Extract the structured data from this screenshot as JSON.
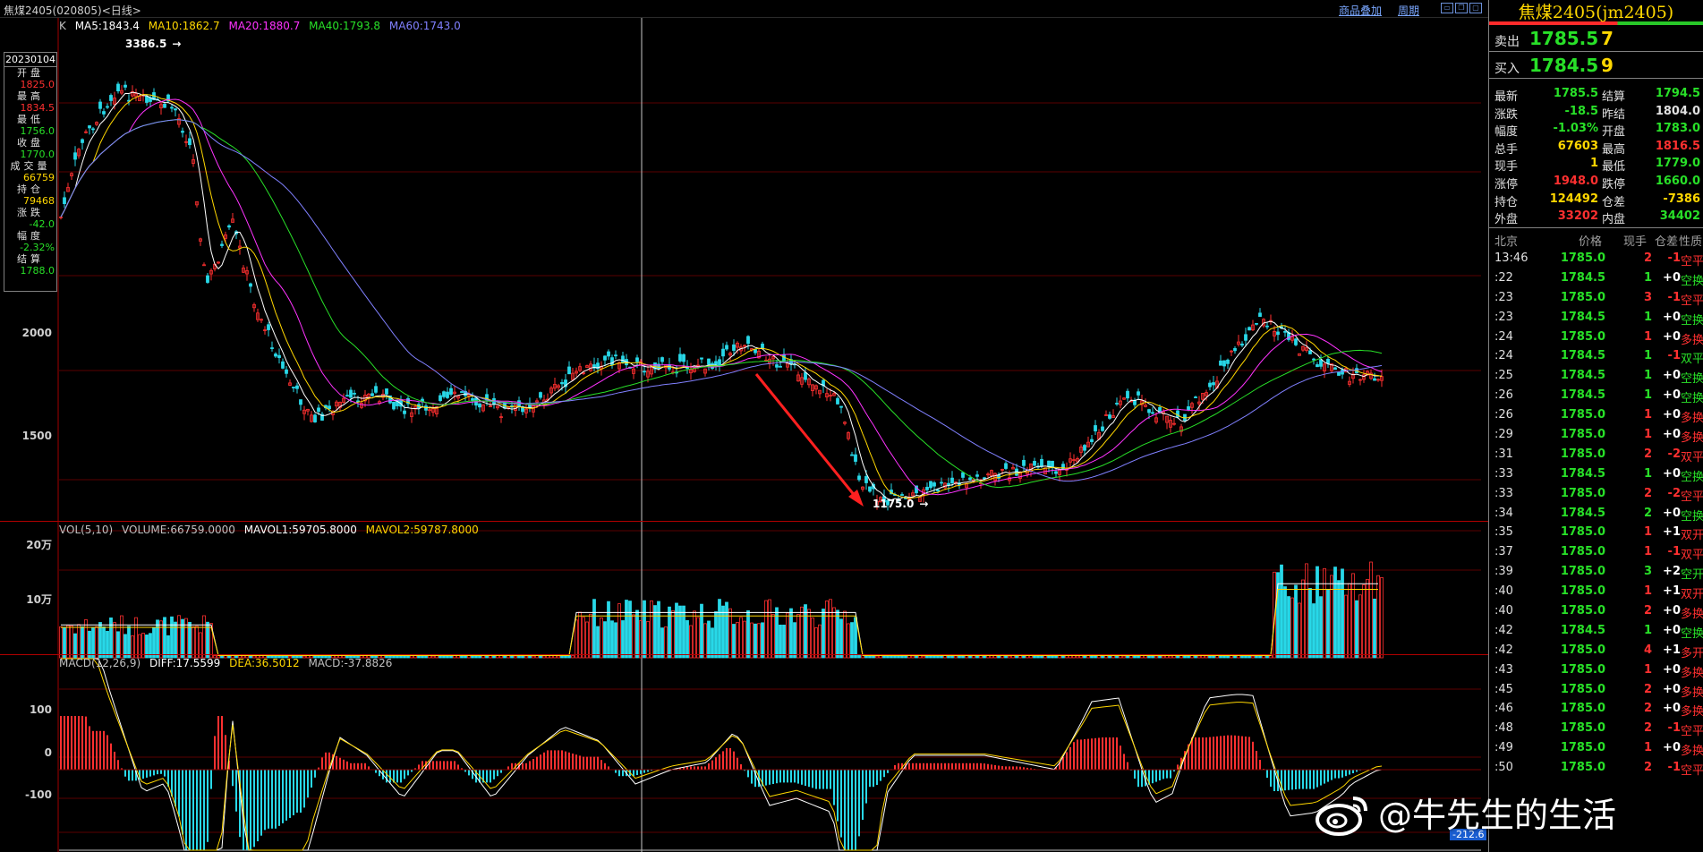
{
  "window": {
    "title": "焦煤2405(020805)<日线>",
    "links": [
      "商品叠加",
      "周期"
    ]
  },
  "kline": {
    "label": "K",
    "ma": [
      {
        "text": "MA5:1843.4",
        "color": "#ffffff"
      },
      {
        "text": "MA10:1862.7",
        "color": "#ffd700"
      },
      {
        "text": "MA20:1880.7",
        "color": "#ff33ff"
      },
      {
        "text": "MA40:1793.8",
        "color": "#28e028"
      },
      {
        "text": "MA60:1743.0",
        "color": "#8080ff"
      }
    ],
    "y_ticks": [
      "2000",
      "1500"
    ],
    "high_label": "3386.5",
    "low_label": "1175.0"
  },
  "info_box": {
    "date": "20230104",
    "items": [
      {
        "label": "开盘",
        "value": "1825.0",
        "color": "#ff3030"
      },
      {
        "label": "最高",
        "value": "1834.5",
        "color": "#ff3030"
      },
      {
        "label": "最低",
        "value": "1756.0",
        "color": "#28e028"
      },
      {
        "label": "收盘",
        "value": "1770.0",
        "color": "#28e028"
      },
      {
        "label": "成交量",
        "value": "66759",
        "color": "#ffd700"
      },
      {
        "label": "持仓",
        "value": "79468",
        "color": "#ffd700"
      },
      {
        "label": "涨跌",
        "value": "-42.0",
        "color": "#28e028"
      },
      {
        "label": "幅度",
        "value": "-2.32%",
        "color": "#28e028"
      },
      {
        "label": "结算",
        "value": "1788.0",
        "color": "#28e028"
      }
    ]
  },
  "volume": {
    "legend": [
      {
        "text": "VOL(5,10)",
        "color": "#c0c0c0"
      },
      {
        "text": "VOLUME:66759.0000",
        "color": "#c0c0c0"
      },
      {
        "text": "MAVOL1:59705.8000",
        "color": "#ffffff"
      },
      {
        "text": "MAVOL2:59787.8000",
        "color": "#ffd700"
      }
    ],
    "y_ticks": [
      "20万",
      "10万"
    ]
  },
  "macd": {
    "legend": [
      {
        "text": "MACD(12,26,9)",
        "color": "#c0c0c0"
      },
      {
        "text": "DIFF:17.5599",
        "color": "#ffffff"
      },
      {
        "text": "DEA:36.5012",
        "color": "#ffd700"
      },
      {
        "text": "MACD:-37.8826",
        "color": "#c0c0c0"
      }
    ],
    "y_ticks": [
      "100",
      "0",
      "-100"
    ],
    "low_label": "-212.6"
  },
  "panel": {
    "title": "焦煤2405(jm2405)",
    "sell": {
      "label": "卖出",
      "price": "1785.5",
      "volume": "7"
    },
    "buy": {
      "label": "买入",
      "price": "1784.5",
      "volume": "9"
    },
    "stats": [
      {
        "k1": "最新",
        "v1": "1785.5",
        "c1": "#28e028",
        "k2": "结算",
        "v2": "1794.5",
        "c2": "#28e028"
      },
      {
        "k1": "涨跌",
        "v1": "-18.5",
        "c1": "#28e028",
        "k2": "昨结",
        "v2": "1804.0",
        "c2": "#e0e0e0"
      },
      {
        "k1": "幅度",
        "v1": "-1.03%",
        "c1": "#28e028",
        "k2": "开盘",
        "v2": "1783.0",
        "c2": "#28e028"
      },
      {
        "k1": "总手",
        "v1": "67603",
        "c1": "#ffd700",
        "k2": "最高",
        "v2": "1816.5",
        "c2": "#ff3030"
      },
      {
        "k1": "现手",
        "v1": "1",
        "c1": "#ffd700",
        "k2": "最低",
        "v2": "1779.0",
        "c2": "#28e028"
      },
      {
        "k1": "涨停",
        "v1": "1948.0",
        "c1": "#ff3030",
        "k2": "跌停",
        "v2": "1660.0",
        "c2": "#28e028"
      },
      {
        "k1": "持仓",
        "v1": "124492",
        "c1": "#ffd700",
        "k2": "仓差",
        "v2": "-7386",
        "c2": "#ffd700"
      },
      {
        "k1": "外盘",
        "v1": "33202",
        "c1": "#ff3030",
        "k2": "内盘",
        "v2": "34402",
        "c2": "#28e028"
      }
    ],
    "tick_headers": [
      "北京",
      "价格",
      "现手",
      "仓差",
      "性质"
    ],
    "ticks": [
      {
        "time": "13:46",
        "price": "1785.0",
        "pc": "#28e028",
        "vol": "2",
        "vc": "#ff3030",
        "oi": "-1",
        "nature": "空平",
        "nc": "#ff3030"
      },
      {
        "time": ":22",
        "price": "1784.5",
        "pc": "#28e028",
        "vol": "1",
        "vc": "#28e028",
        "oi": "+0",
        "nature": "空换",
        "nc": "#28e028"
      },
      {
        "time": ":23",
        "price": "1785.0",
        "pc": "#28e028",
        "vol": "3",
        "vc": "#ff3030",
        "oi": "-1",
        "nature": "空平",
        "nc": "#ff3030"
      },
      {
        "time": ":23",
        "price": "1784.5",
        "pc": "#28e028",
        "vol": "1",
        "vc": "#28e028",
        "oi": "+0",
        "nature": "空换",
        "nc": "#28e028"
      },
      {
        "time": ":24",
        "price": "1785.0",
        "pc": "#28e028",
        "vol": "1",
        "vc": "#ff3030",
        "oi": "+0",
        "nature": "多换",
        "nc": "#ff3030"
      },
      {
        "time": ":24",
        "price": "1784.5",
        "pc": "#28e028",
        "vol": "1",
        "vc": "#28e028",
        "oi": "-1",
        "nature": "双平",
        "nc": "#28e028"
      },
      {
        "time": ":25",
        "price": "1784.5",
        "pc": "#28e028",
        "vol": "1",
        "vc": "#28e028",
        "oi": "+0",
        "nature": "空换",
        "nc": "#28e028"
      },
      {
        "time": ":26",
        "price": "1784.5",
        "pc": "#28e028",
        "vol": "1",
        "vc": "#28e028",
        "oi": "+0",
        "nature": "空换",
        "nc": "#28e028"
      },
      {
        "time": ":26",
        "price": "1785.0",
        "pc": "#28e028",
        "vol": "1",
        "vc": "#ff3030",
        "oi": "+0",
        "nature": "多换",
        "nc": "#ff3030"
      },
      {
        "time": ":29",
        "price": "1785.0",
        "pc": "#28e028",
        "vol": "1",
        "vc": "#ff3030",
        "oi": "+0",
        "nature": "多换",
        "nc": "#ff3030"
      },
      {
        "time": ":31",
        "price": "1785.0",
        "pc": "#28e028",
        "vol": "2",
        "vc": "#ff3030",
        "oi": "-2",
        "nature": "双平",
        "nc": "#ff3030"
      },
      {
        "time": ":33",
        "price": "1784.5",
        "pc": "#28e028",
        "vol": "1",
        "vc": "#28e028",
        "oi": "+0",
        "nature": "空换",
        "nc": "#28e028"
      },
      {
        "time": ":33",
        "price": "1785.0",
        "pc": "#28e028",
        "vol": "2",
        "vc": "#ff3030",
        "oi": "-2",
        "nature": "空平",
        "nc": "#ff3030"
      },
      {
        "time": ":34",
        "price": "1784.5",
        "pc": "#28e028",
        "vol": "2",
        "vc": "#28e028",
        "oi": "+0",
        "nature": "空换",
        "nc": "#28e028"
      },
      {
        "time": ":35",
        "price": "1785.0",
        "pc": "#28e028",
        "vol": "1",
        "vc": "#ff3030",
        "oi": "+1",
        "nature": "双开",
        "nc": "#ff3030"
      },
      {
        "time": ":37",
        "price": "1785.0",
        "pc": "#28e028",
        "vol": "1",
        "vc": "#ff3030",
        "oi": "-1",
        "nature": "双平",
        "nc": "#ff3030"
      },
      {
        "time": ":39",
        "price": "1785.0",
        "pc": "#28e028",
        "vol": "3",
        "vc": "#28e028",
        "oi": "+2",
        "nature": "空开",
        "nc": "#28e028"
      },
      {
        "time": ":40",
        "price": "1785.0",
        "pc": "#28e028",
        "vol": "1",
        "vc": "#ff3030",
        "oi": "+1",
        "nature": "双开",
        "nc": "#ff3030"
      },
      {
        "time": ":40",
        "price": "1785.0",
        "pc": "#28e028",
        "vol": "2",
        "vc": "#ff3030",
        "oi": "+0",
        "nature": "多换",
        "nc": "#ff3030"
      },
      {
        "time": ":42",
        "price": "1784.5",
        "pc": "#28e028",
        "vol": "1",
        "vc": "#28e028",
        "oi": "+0",
        "nature": "空换",
        "nc": "#28e028"
      },
      {
        "time": ":42",
        "price": "1785.0",
        "pc": "#28e028",
        "vol": "4",
        "vc": "#ff3030",
        "oi": "+1",
        "nature": "多开",
        "nc": "#ff3030"
      },
      {
        "time": ":43",
        "price": "1785.0",
        "pc": "#28e028",
        "vol": "1",
        "vc": "#ff3030",
        "oi": "+0",
        "nature": "多换",
        "nc": "#ff3030"
      },
      {
        "time": ":45",
        "price": "1785.0",
        "pc": "#28e028",
        "vol": "2",
        "vc": "#ff3030",
        "oi": "+0",
        "nature": "多换",
        "nc": "#ff3030"
      },
      {
        "time": ":46",
        "price": "1785.0",
        "pc": "#28e028",
        "vol": "2",
        "vc": "#ff3030",
        "oi": "+0",
        "nature": "多换",
        "nc": "#ff3030"
      },
      {
        "time": ":48",
        "price": "1785.0",
        "pc": "#28e028",
        "vol": "2",
        "vc": "#ff3030",
        "oi": "-1",
        "nature": "空平",
        "nc": "#ff3030"
      },
      {
        "time": ":49",
        "price": "1785.0",
        "pc": "#28e028",
        "vol": "1",
        "vc": "#ff3030",
        "oi": "+0",
        "nature": "多换",
        "nc": "#ff3030"
      },
      {
        "time": ":50",
        "price": "1785.0",
        "pc": "#28e028",
        "vol": "2",
        "vc": "#ff3030",
        "oi": "-1",
        "nature": "空平",
        "nc": "#ff3030"
      }
    ]
  },
  "watermark": "@牛先生的生活"
}
